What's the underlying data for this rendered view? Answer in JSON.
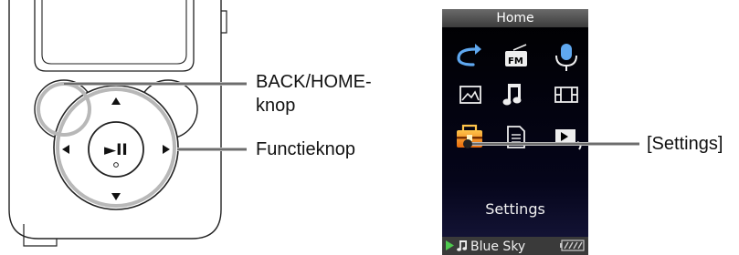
{
  "callouts": {
    "back_home_line1": "BACK/HOME-",
    "back_home_line2": "knop",
    "function_button": "Functieknop",
    "settings_bracket": "[Settings]"
  },
  "device": {
    "play_pause_symbol": "►II"
  },
  "screen": {
    "header_title": "Home",
    "selected_label": "Settings",
    "now_playing": "Blue Sky",
    "icons": [
      "repeat-icon",
      "fm-radio-icon",
      "microphone-icon",
      "photo-icon",
      "music-note-icon",
      "video-film-icon",
      "toolbox-settings-icon",
      "document-icon",
      "now-playing-icon"
    ],
    "accent_color": "#f7941d",
    "header_color": "#555555",
    "background_color": "#000000"
  }
}
